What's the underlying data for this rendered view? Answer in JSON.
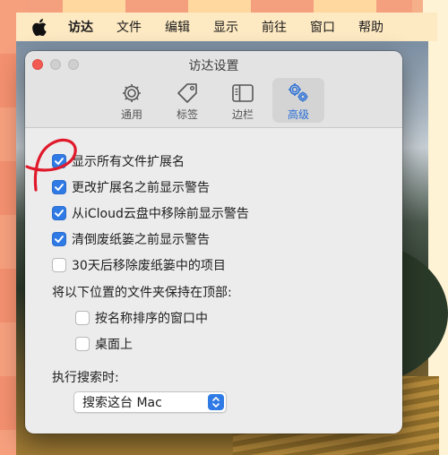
{
  "menubar": {
    "items": [
      "访达",
      "文件",
      "编辑",
      "显示",
      "前往",
      "窗口",
      "帮助"
    ]
  },
  "window": {
    "title": "访达设置",
    "tabs": [
      {
        "label": "通用",
        "icon": "gear-icon",
        "active": false
      },
      {
        "label": "标签",
        "icon": "tag-icon",
        "active": false
      },
      {
        "label": "边栏",
        "icon": "sidebar-icon",
        "active": false
      },
      {
        "label": "高级",
        "icon": "gears-icon",
        "active": true
      }
    ]
  },
  "options": [
    {
      "label": "显示所有文件扩展名",
      "checked": true
    },
    {
      "label": "更改扩展名之前显示警告",
      "checked": true
    },
    {
      "label": "从iCloud云盘中移除前显示警告",
      "checked": true
    },
    {
      "label": "清倒废纸篓之前显示警告",
      "checked": true
    },
    {
      "label": "30天后移除废纸篓中的项目",
      "checked": false
    }
  ],
  "folders_on_top": {
    "heading": "将以下位置的文件夹保持在顶部:",
    "options": [
      {
        "label": "按名称排序的窗口中",
        "checked": false
      },
      {
        "label": "桌面上",
        "checked": false
      }
    ]
  },
  "search": {
    "heading": "执行搜索时:",
    "selected": "搜索这台 Mac"
  },
  "colors": {
    "accent": "#2f7ae5",
    "close_button": "#f25a52",
    "annotation_stroke": "#e0192b"
  }
}
